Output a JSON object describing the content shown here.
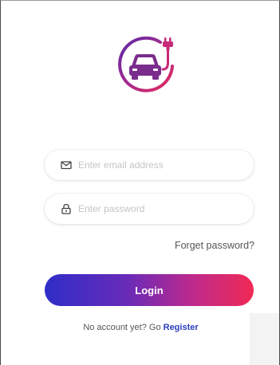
{
  "login_form": {
    "email_placeholder": "Enter email address",
    "password_placeholder": "Enter password",
    "forgot_password_label": "Forget password?",
    "login_button_label": "Login",
    "register_prompt": "No account yet? Go ",
    "register_link_label": "Register"
  },
  "icons": {
    "logo": "ev-car-charging-logo",
    "email": "envelope-icon",
    "password": "lock-icon"
  },
  "colors": {
    "gradient_start": "#2f2cc8",
    "gradient_end": "#f02a55",
    "logo_car": "#7a2c8c",
    "link": "#2b3fbf"
  }
}
